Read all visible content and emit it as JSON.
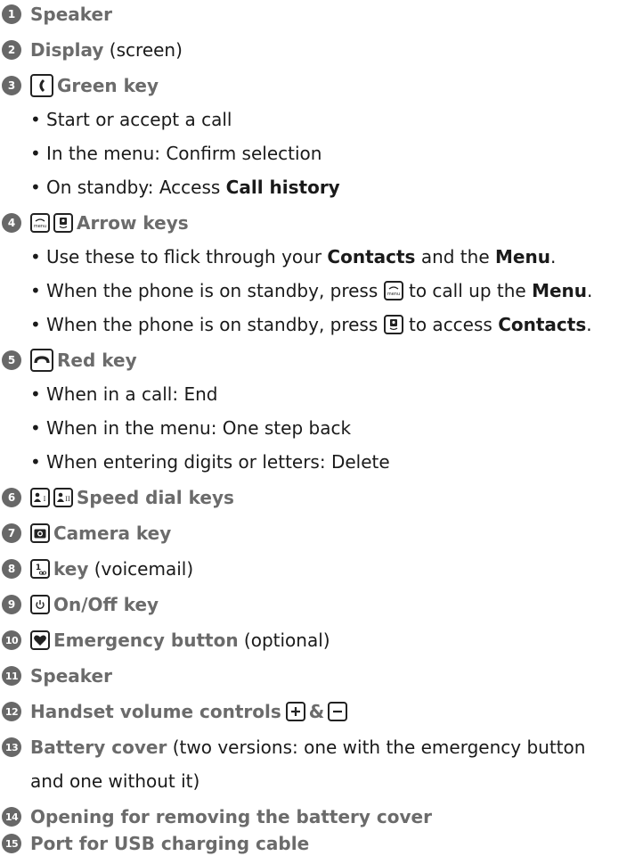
{
  "items": [
    {
      "num": "1",
      "label": "Speaker",
      "suffix": ""
    },
    {
      "num": "2",
      "label": "Display",
      "suffix": " (screen)"
    },
    {
      "num": "3",
      "label": "Green key",
      "suffix": "",
      "bullets": [
        "Start or accept a call",
        "In the menu: Confirm selection"
      ],
      "bullet3": {
        "text": "On standby: Access ",
        "bold": "Call history"
      }
    },
    {
      "num": "4",
      "label": "Arrow keys",
      "suffix": "",
      "b1": {
        "a": "Use these to flick through your ",
        "bold1": "Contacts",
        "b": " and the ",
        "bold2": "Menu",
        "c": "."
      },
      "b2": {
        "a": "When the phone is on standby, press ",
        "b": " to call up the ",
        "bold": "Menu",
        "c": "."
      },
      "b3": {
        "a": "When the phone is on standby, press ",
        "b": " to access ",
        "bold": "Contacts",
        "c": "."
      }
    },
    {
      "num": "5",
      "label": "Red key",
      "suffix": "",
      "bullets": [
        "When in a call: End",
        "When in the menu: One step back",
        "When entering digits or letters: Delete"
      ]
    },
    {
      "num": "6",
      "label": "Speed dial keys",
      "suffix": ""
    },
    {
      "num": "7",
      "label": "Camera key",
      "suffix": ""
    },
    {
      "num": "8",
      "label": "key",
      "suffix": " (voicemail)"
    },
    {
      "num": "9",
      "label": "On/Off key",
      "suffix": ""
    },
    {
      "num": "10",
      "label": "Emergency button",
      "suffix": " (optional)"
    },
    {
      "num": "11",
      "label": "Speaker",
      "suffix": ""
    },
    {
      "num": "12",
      "label": "Handset volume controls",
      "amp": "&",
      "suffix": ""
    },
    {
      "num": "13",
      "label": "Battery cover",
      "suffix": " (two versions: one with the emergency button",
      "cont": "and one without it)"
    },
    {
      "num": "14",
      "label": "Opening for removing the battery cover",
      "suffix": ""
    },
    {
      "num": "15",
      "label": "Port for USB charging cable",
      "suffix": ""
    }
  ],
  "bullet_char": "•",
  "icon_glyphs": {
    "menu": "menu",
    "speed1": "I",
    "speed2": "II",
    "voicemail": "1"
  },
  "colors": {
    "label": "#6b6b6b",
    "badge": "#686868",
    "text": "#1a1a1a"
  }
}
